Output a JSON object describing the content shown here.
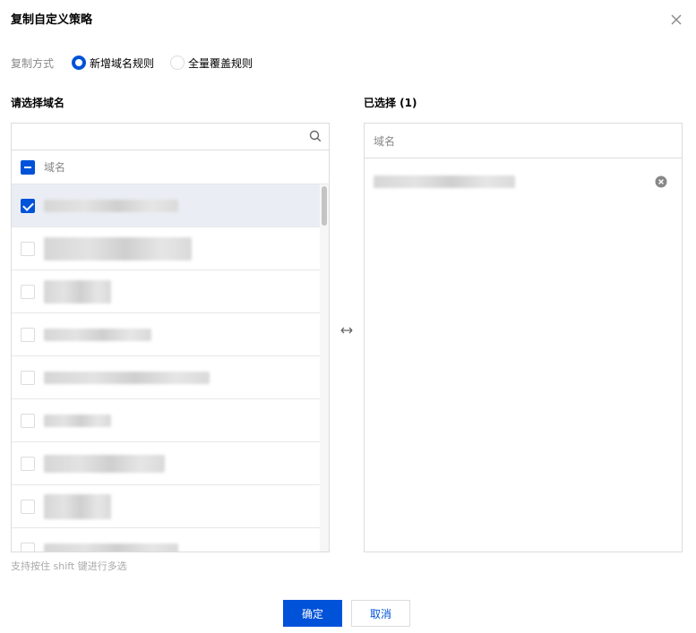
{
  "dialog": {
    "title": "复制自定义策略",
    "close_icon": "close-icon"
  },
  "copy_mode": {
    "label": "复制方式",
    "options": [
      {
        "label": "新增域名规则",
        "checked": true
      },
      {
        "label": "全量覆盖规则",
        "checked": false
      }
    ]
  },
  "source": {
    "title": "请选择域名",
    "search_value": "",
    "header": "域名",
    "header_state": "indeterminate",
    "rows": [
      {
        "checked": true,
        "selected": true
      },
      {
        "checked": false,
        "selected": false
      },
      {
        "checked": false,
        "selected": false
      },
      {
        "checked": false,
        "selected": false
      },
      {
        "checked": false,
        "selected": false
      },
      {
        "checked": false,
        "selected": false
      },
      {
        "checked": false,
        "selected": false
      },
      {
        "checked": false,
        "selected": false
      },
      {
        "checked": false,
        "selected": false
      }
    ]
  },
  "target": {
    "title": "已选择 (1)",
    "header": "域名"
  },
  "hint": "支持按住 shift 键进行多选",
  "actions": {
    "confirm": "确定",
    "cancel": "取消"
  }
}
